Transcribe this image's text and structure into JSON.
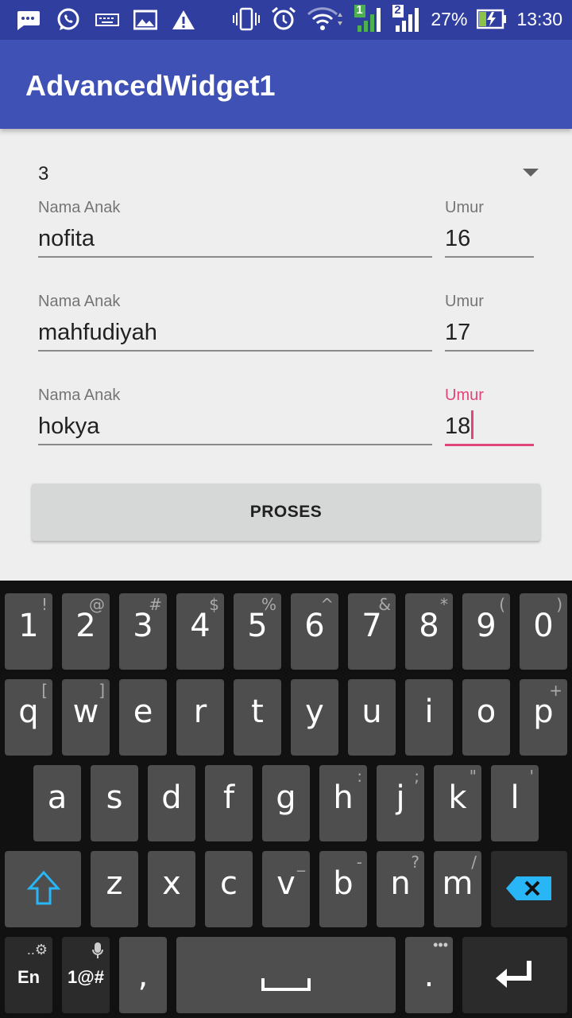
{
  "status_bar": {
    "battery": "27%",
    "time": "13:30",
    "sim1": "1",
    "sim2": "2"
  },
  "app_bar": {
    "title": "AdvancedWidget1"
  },
  "spinner": {
    "value": "3"
  },
  "children": [
    {
      "name_label": "Nama Anak",
      "name_value": "nofita",
      "age_label": "Umur",
      "age_value": "16"
    },
    {
      "name_label": "Nama Anak",
      "name_value": "mahfudiyah",
      "age_label": "Umur",
      "age_value": "17"
    },
    {
      "name_label": "Nama Anak",
      "name_value": "hokya",
      "age_label": "Umur",
      "age_value": "18"
    }
  ],
  "button": {
    "label": "PROSES"
  },
  "keyboard": {
    "row1": [
      {
        "k": "1",
        "h": "!"
      },
      {
        "k": "2",
        "h": "@"
      },
      {
        "k": "3",
        "h": "#"
      },
      {
        "k": "4",
        "h": "$"
      },
      {
        "k": "5",
        "h": "%"
      },
      {
        "k": "6",
        "h": "^"
      },
      {
        "k": "7",
        "h": "&"
      },
      {
        "k": "8",
        "h": "*"
      },
      {
        "k": "9",
        "h": "("
      },
      {
        "k": "0",
        "h": ")"
      }
    ],
    "row2": [
      {
        "k": "q",
        "h": "["
      },
      {
        "k": "w",
        "h": "]"
      },
      {
        "k": "e",
        "h": ""
      },
      {
        "k": "r",
        "h": ""
      },
      {
        "k": "t",
        "h": ""
      },
      {
        "k": "y",
        "h": ""
      },
      {
        "k": "u",
        "h": ""
      },
      {
        "k": "i",
        "h": ""
      },
      {
        "k": "o",
        "h": ""
      },
      {
        "k": "p",
        "h": "+"
      }
    ],
    "row3": [
      {
        "k": "a",
        "h": ""
      },
      {
        "k": "s",
        "h": ""
      },
      {
        "k": "d",
        "h": ""
      },
      {
        "k": "f",
        "h": ""
      },
      {
        "k": "g",
        "h": ""
      },
      {
        "k": "h",
        "h": ":"
      },
      {
        "k": "j",
        "h": ";"
      },
      {
        "k": "k",
        "h": "\""
      },
      {
        "k": "l",
        "h": "'"
      }
    ],
    "row4": [
      {
        "k": "z",
        "h": ""
      },
      {
        "k": "x",
        "h": ""
      },
      {
        "k": "c",
        "h": ""
      },
      {
        "k": "v",
        "h": "_"
      },
      {
        "k": "b",
        "h": "-"
      },
      {
        "k": "n",
        "h": "?"
      },
      {
        "k": "m",
        "h": "/"
      }
    ],
    "lang_label": "En",
    "symbols_label": "1@#",
    "comma": ",",
    "period": "."
  },
  "colors": {
    "primary": "#3f51b5",
    "primary_dark": "#303f9f",
    "accent": "#e0457b"
  }
}
